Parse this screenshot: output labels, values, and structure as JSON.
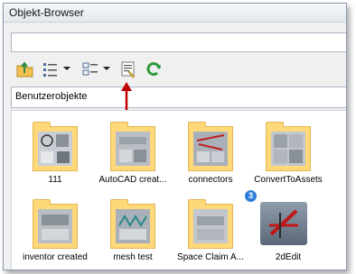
{
  "window": {
    "title": "Objekt-Browser"
  },
  "path": {
    "value": ""
  },
  "toolbar": {
    "icons": [
      "folder-up-icon",
      "list-view-icon",
      "details-view-icon",
      "properties-icon",
      "refresh-icon"
    ]
  },
  "filter": {
    "selected": "Benutzerobjekte"
  },
  "items": [
    {
      "label": "111",
      "type": "folder"
    },
    {
      "label": "AutoCAD creat...",
      "type": "folder"
    },
    {
      "label": "connectors",
      "type": "folder"
    },
    {
      "label": "ConvertToAssets",
      "type": "folder"
    },
    {
      "label": "inventor created",
      "type": "folder"
    },
    {
      "label": "mesh test",
      "type": "folder"
    },
    {
      "label": "Space Claim A...",
      "type": "folder"
    },
    {
      "label": "2dEdit",
      "type": "object",
      "badge": "3"
    }
  ],
  "colors": {
    "folder": "#ffd879",
    "annotation": "#c00000",
    "refresh": "#2e9a3c"
  }
}
